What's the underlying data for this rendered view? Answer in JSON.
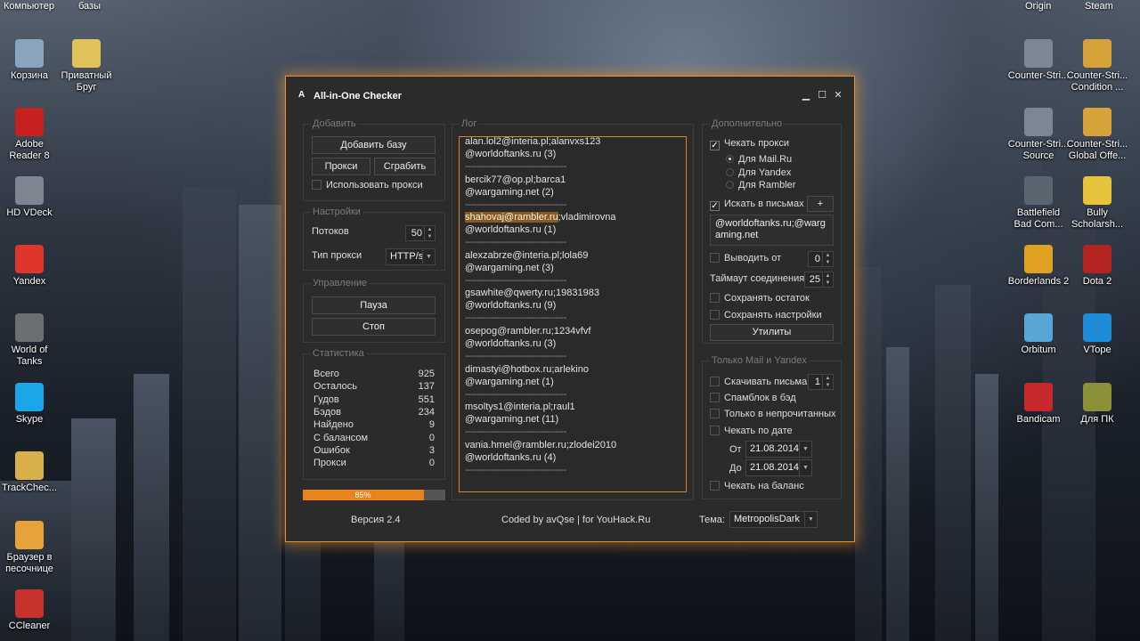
{
  "desktop": {
    "top_labels": [
      "Компьютер",
      "базы",
      "Origin",
      "Steam"
    ],
    "left_icons": [
      {
        "label": "Корзина",
        "icon": "recycle-bin-icon",
        "color": "#8aa4bf"
      },
      {
        "label": "Приватный Бруг",
        "icon": "folder-icon",
        "color": "#e1c15a"
      },
      {
        "label": "Adobe Reader 8",
        "icon": "adobe-reader-icon",
        "color": "#c8201e"
      },
      {
        "label": "HD VDeck",
        "icon": "hd-vdeck-icon",
        "color": "#7d8590"
      },
      {
        "label": "Yandex",
        "icon": "yandex-browser-icon",
        "color": "#e0352b"
      },
      {
        "label": "World of Tanks",
        "icon": "world-of-tanks-icon",
        "color": "#6b6f72"
      },
      {
        "label": "Skype",
        "icon": "skype-icon",
        "color": "#18a6e8"
      },
      {
        "label": "TrackChec...",
        "icon": "track-checker-icon",
        "color": "#d7b04a"
      },
      {
        "label": "Браузер в песочнице",
        "icon": "sandbox-browser-icon",
        "color": "#e8a23a"
      },
      {
        "label": "CCleaner",
        "icon": "ccleaner-icon",
        "color": "#c7332c"
      }
    ],
    "right_icons": [
      {
        "label": "Counter-Stri...",
        "icon": "counter-strike-icon",
        "color": "#7b8795"
      },
      {
        "label": "Counter-Stri... Condition ...",
        "icon": "counter-strike-cz-icon",
        "color": "#d6a33a"
      },
      {
        "label": "Counter-Stri... Source",
        "icon": "counter-strike-source-icon",
        "color": "#7b8795"
      },
      {
        "label": "Counter-Stri... Global Offe...",
        "icon": "counter-strike-go-icon",
        "color": "#d6a33a"
      },
      {
        "label": "Battlefield Bad Com...",
        "icon": "battlefield-icon",
        "color": "#5b6570"
      },
      {
        "label": "Bully Scholarsh...",
        "icon": "bully-icon",
        "color": "#e6c33a"
      },
      {
        "label": "Borderlands 2",
        "icon": "borderlands-icon",
        "color": "#e0a020"
      },
      {
        "label": "Dota 2",
        "icon": "dota2-icon",
        "color": "#b2241f"
      },
      {
        "label": "Orbitum",
        "icon": "orbitum-icon",
        "color": "#58a6d6"
      },
      {
        "label": "VTope",
        "icon": "vtope-icon",
        "color": "#1f8bd8"
      },
      {
        "label": "Bandicam",
        "icon": "bandicam-icon",
        "color": "#c7282a"
      },
      {
        "label": "Для ПК",
        "icon": "for-pc-icon",
        "color": "#8b8f38"
      }
    ]
  },
  "window": {
    "title": "All-in-One Checker",
    "controls": {
      "minimize": "▁",
      "maximize": "☐",
      "close": "✕"
    },
    "add_group": {
      "title": "Добавить",
      "add_base": "Добавить базу",
      "proxy": "Прокси",
      "grab": "Сграбить",
      "use_proxy": "Использовать прокси"
    },
    "settings_group": {
      "title": "Настройки",
      "threads_label": "Потоков",
      "threads_value": "50",
      "proxy_type_label": "Тип прокси",
      "proxy_type_value": "HTTP/s"
    },
    "control_group": {
      "title": "Управление",
      "pause": "Пауза",
      "stop": "Стоп"
    },
    "stats_group": {
      "title": "Статистика",
      "rows": [
        {
          "k": "Всего",
          "v": "925"
        },
        {
          "k": "Осталось",
          "v": "137"
        },
        {
          "k": "Гудов",
          "v": "551"
        },
        {
          "k": "Бэдов",
          "v": "234"
        },
        {
          "k": "Найдено",
          "v": "9"
        },
        {
          "k": "С балансом",
          "v": "0"
        },
        {
          "k": "Ошибок",
          "v": "3"
        },
        {
          "k": "Прокси",
          "v": "0"
        }
      ]
    },
    "progress": {
      "percent": 85,
      "label": "85%"
    },
    "log_group": {
      "title": "Лог",
      "separator": "------------------------------------",
      "entries": [
        {
          "line1": "alan.lol2@interia.pl;alanvxs123",
          "line2": "@worldoftanks.ru (3)"
        },
        {
          "line1": "bercik77@op.pl;barca1",
          "line2": "@wargaming.net (2)"
        },
        {
          "line1_hl": "shahovaj@rambler.ru",
          "line1": ";vladimirovna",
          "line2": "@worldoftanks.ru (1)"
        },
        {
          "line1": "alexzabrze@interia.pl;lola69",
          "line2": "@wargaming.net (3)"
        },
        {
          "line1": "gsawhite@qwerty.ru;19831983",
          "line2": "@worldoftanks.ru (9)"
        },
        {
          "line1": "osepog@rambler.ru;1234vfvf",
          "line2": "@worldoftanks.ru (3)"
        },
        {
          "line1": "dimastyi@hotbox.ru;arlekino",
          "line2": "@wargaming.net (1)"
        },
        {
          "line1": "msoltys1@interia.pl;raul1",
          "line2": "@wargaming.net (11)"
        },
        {
          "line1": "vania.hmel@rambler.ru;zlodei2010",
          "line2": "@worldoftanks.ru (4)"
        }
      ]
    },
    "extra_group": {
      "title": "Дополнительно",
      "check_proxy": "Чекать прокси",
      "radio_mailru": "Для Mail.Ru",
      "radio_yandex": "Для Yandex",
      "radio_rambler": "Для Rambler",
      "search_letters": "Искать в письмах",
      "plus": "+",
      "search_text": "@worldoftanks.ru;@wargaming.net",
      "output_from": "Выводить от",
      "output_from_value": "0",
      "timeout": "Таймаут соединения",
      "timeout_value": "25",
      "save_rest": "Сохранять остаток",
      "save_settings": "Сохранять настройки",
      "utilities": "Утилиты"
    },
    "mail_group": {
      "title": "Только Mail и Yandex",
      "download_letters": "Скачивать письма",
      "download_value": "1",
      "spamblock": "Спамблок в бэд",
      "unread_only": "Только в непрочитанных",
      "check_by_date": "Чекать по дате",
      "from_label": "От",
      "from_date": "21.08.2014",
      "to_label": "До",
      "to_date": "21.08.2014",
      "check_balance": "Чекать на баланс"
    },
    "footer": {
      "version": "Версия 2.4",
      "credits": "Coded by avQse | for YouHack.Ru",
      "theme_label": "Тема:",
      "theme_value": "MetropolisDark"
    }
  }
}
